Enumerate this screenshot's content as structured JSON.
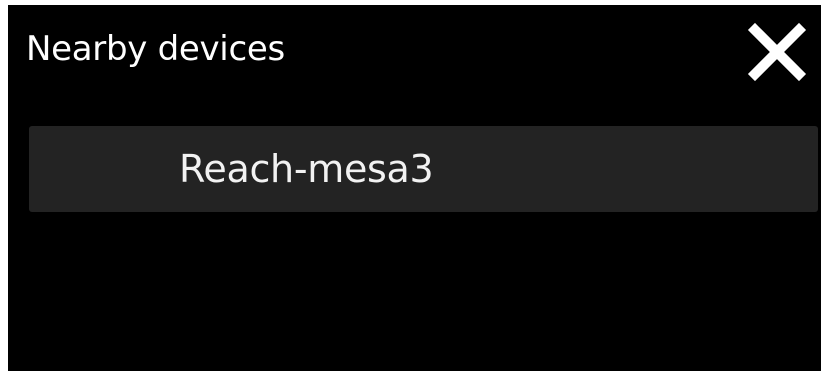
{
  "dialog": {
    "title": "Nearby devices",
    "close_icon": "close-icon",
    "background_color": "#000000",
    "text_color": "#ffffff"
  },
  "devices": [
    {
      "label": "Reach-mesa3",
      "background_color": "#232323"
    }
  ]
}
